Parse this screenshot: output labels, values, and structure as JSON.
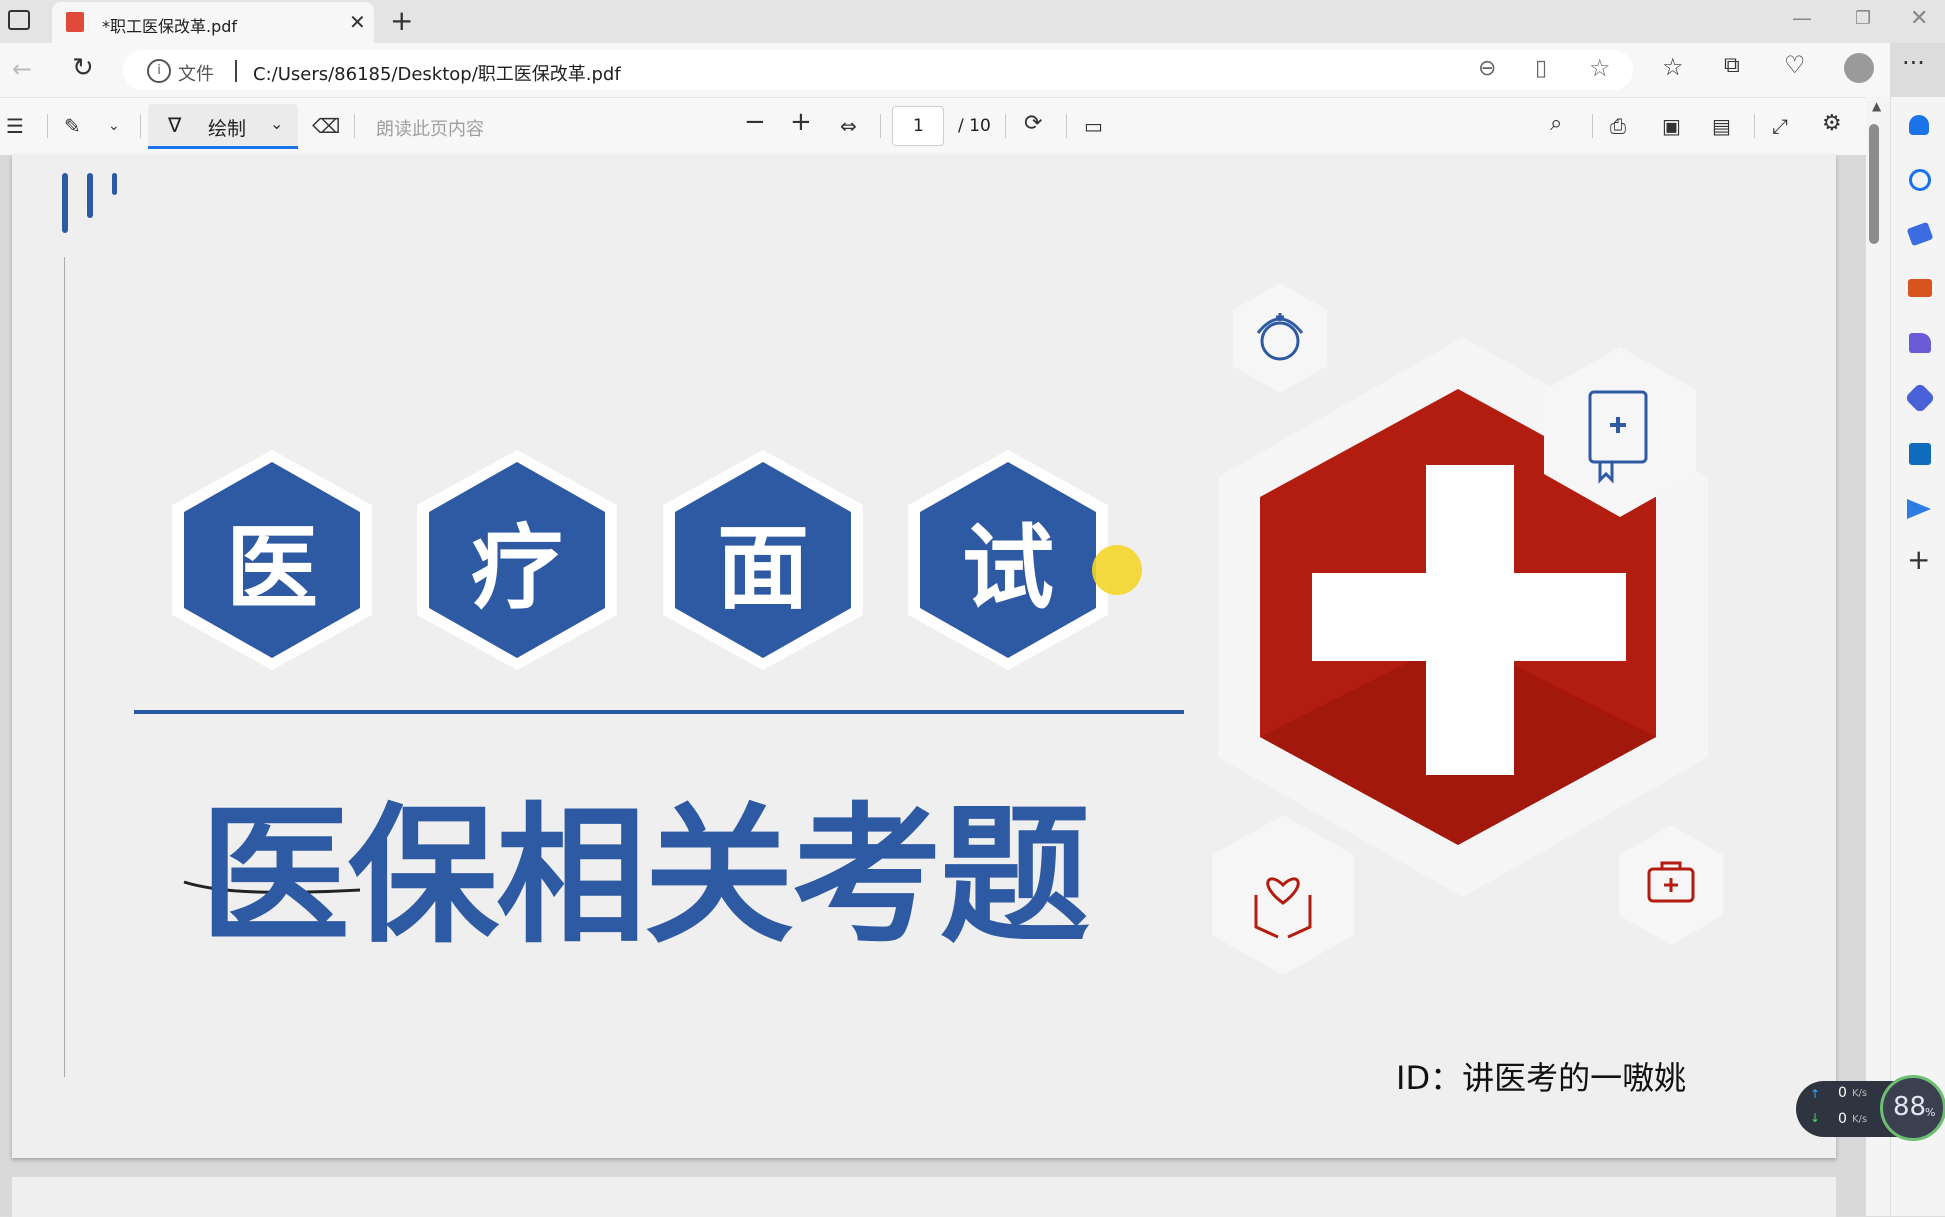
{
  "tab": {
    "title": "*职工医保改革.pdf",
    "icon": "pdf-icon"
  },
  "address": {
    "file_label": "文件",
    "url": "C:/Users/86185/Desktop/职工医保改革.pdf"
  },
  "pdf_toolbar": {
    "draw_label": "绘制",
    "read_aloud": "朗读此页内容",
    "page_number": "1",
    "page_total": "/ 10"
  },
  "content": {
    "hex_titles": [
      "医",
      "疗",
      "面",
      "试"
    ],
    "main_title": "医保相关考题",
    "id_text": "ID：讲医考的一嗷姚"
  },
  "net_widget": {
    "up": "0",
    "up_unit": "K/s",
    "down": "0",
    "down_unit": "K/s",
    "percent": "88",
    "percent_unit": "%"
  },
  "colors": {
    "blue": "#2e5aa3",
    "red": "#b21d10",
    "accent": "#1a73e8"
  }
}
